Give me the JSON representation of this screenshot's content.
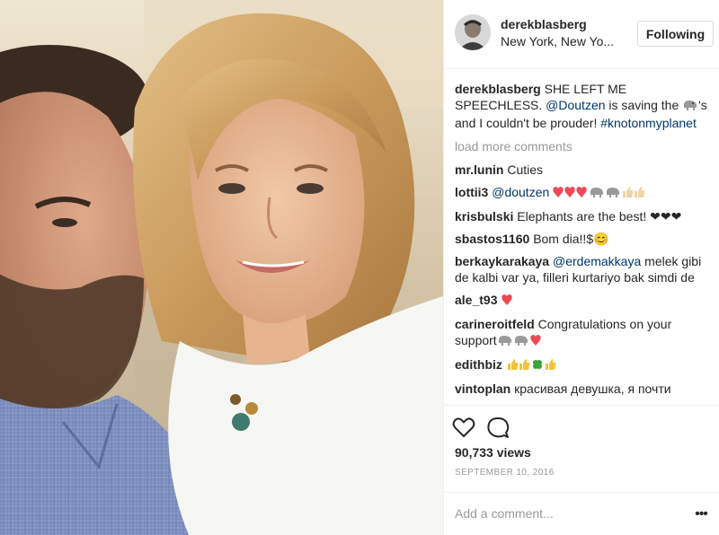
{
  "post": {
    "username": "derekblasberg",
    "location": "New York, New Yo...",
    "follow_label": "Following"
  },
  "caption": {
    "user": "derekblasberg",
    "text_1": " SHE LEFT ME SPEECHLESS. ",
    "mention": "@Doutzen",
    "text_2": " is saving the ",
    "text_3": "'s and I couldn't be prouder! ",
    "hashtag": "#knotonmyplanet"
  },
  "load_more_label": "load more comments",
  "comments": [
    {
      "user": "mr.lunin",
      "text": "Cuties"
    },
    {
      "user": "lottii3",
      "mention": "@doutzen",
      "text": ""
    },
    {
      "user": "krisbulski",
      "text": "Elephants are the best! ❤❤❤"
    },
    {
      "user": "sbastos1160",
      "text": "Bom dia!!$😊"
    },
    {
      "user": "berkaykarakaya",
      "mention": "@erdemakkaya",
      "text": "melek gibi de kalbi var ya, filleri kurtariyo bak simdi de"
    },
    {
      "user": "ale_t93",
      "text": ""
    },
    {
      "user": "carineroitfeld",
      "text": "Congratulations on your support"
    },
    {
      "user": "edithbiz",
      "text": ""
    },
    {
      "user": "vintoplan",
      "text": "красивая девушка, я почти"
    }
  ],
  "stats": {
    "views": "90,733 views",
    "date": "SEPTEMBER 10, 2016"
  },
  "comment_box": {
    "placeholder": "Add a comment..."
  },
  "icons": {
    "like": "heart-icon",
    "comment": "comment-bubble-icon",
    "more": "more-options-icon",
    "elephant": "elephant-emoji",
    "heart": "red-heart-emoji",
    "thumb": "thumbs-up-emoji",
    "clover": "four-leaf-clover-emoji"
  },
  "colors": {
    "text": "#262626",
    "link": "#003569",
    "muted": "#999999",
    "border": "#efefef",
    "heart_red": "#ed4956"
  }
}
